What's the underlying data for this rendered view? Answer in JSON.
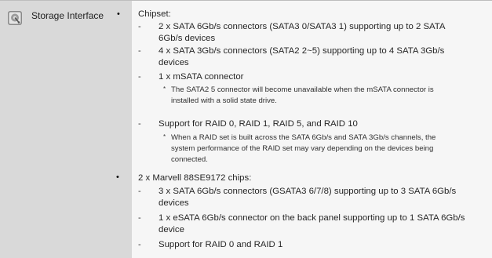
{
  "row": {
    "label": "Storage Interface",
    "icon": "hard-drive-icon"
  },
  "chipset": {
    "heading": "Chipset:",
    "items": [
      {
        "lines": [
          "2 x SATA 6Gb/s connectors (SATA3 0/SATA3 1) supporting up to 2 SATA",
          "6Gb/s devices"
        ]
      },
      {
        "lines": [
          "4 x SATA 3Gb/s connectors (SATA2 2~5) supporting up to 4 SATA 3Gb/s",
          "devices"
        ]
      },
      {
        "lines": [
          "1 x mSATA connector"
        ],
        "note": [
          "The SATA2 5 connector will become unavailable when the mSATA connector is",
          "installed with a solid state drive."
        ]
      },
      {
        "lines": [
          "Support for RAID 0, RAID 1, RAID 5, and RAID 10"
        ],
        "note": [
          "When a RAID set is built across the SATA 6Gb/s and SATA 3Gb/s channels, the",
          "system performance of the RAID set may vary depending on the devices being",
          "connected."
        ]
      }
    ]
  },
  "marvell": {
    "heading": "2 x Marvell 88SE9172 chips:",
    "items": [
      {
        "lines": [
          "3 x SATA 6Gb/s connectors (GSATA3 6/7/8) supporting up to 3 SATA 6Gb/s",
          "devices"
        ]
      },
      {
        "lines": [
          "1 x eSATA 6Gb/s connector on the back panel supporting up to 1 SATA 6Gb/s",
          "device"
        ]
      },
      {
        "lines": [
          "Support for RAID 0 and RAID 1"
        ]
      }
    ]
  }
}
